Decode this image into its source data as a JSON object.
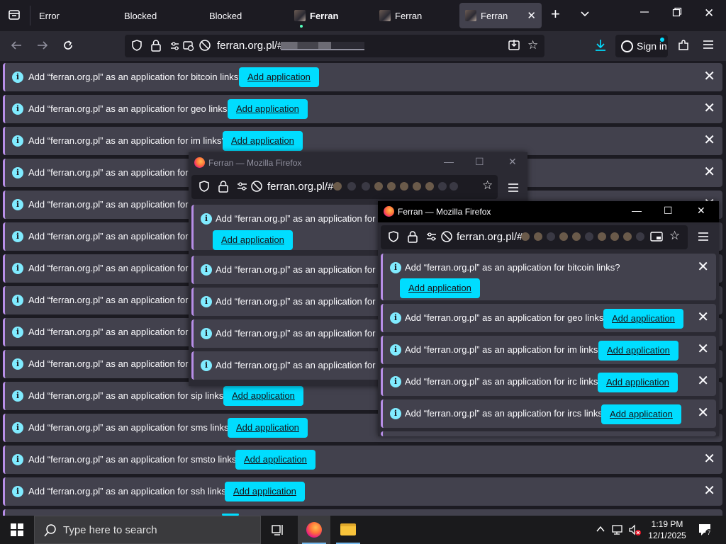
{
  "tabs": [
    {
      "label": "Error"
    },
    {
      "label": "Blocked"
    },
    {
      "label": "Blocked"
    },
    {
      "label": "Ferran"
    },
    {
      "label": "Ferran"
    },
    {
      "label": "Ferran"
    }
  ],
  "navbar": {
    "url": "ferran.org.pl/#",
    "sign_in": "Sign in"
  },
  "notifications": {
    "button_label": "Add application",
    "main": [
      "Add “ferran.org.pl” as an application for bitcoin links?",
      "Add “ferran.org.pl” as an application for geo links?",
      "Add “ferran.org.pl” as an application for im links?",
      "Add “ferran.org.pl” as an application for irc links?",
      "Add “ferran.org.pl” as an application for ircs links?",
      "Add “ferran.org.pl” as an application for mailto links?",
      "Add “ferran.org.pl” as an application for magnet links?",
      "Add “ferran.org.pl” as an application for mms links?",
      "Add “ferran.org.pl” as an application for news links?",
      "Add “ferran.org.pl” as an application for nntp links?",
      "Add “ferran.org.pl” as an application for sip links?",
      "Add “ferran.org.pl” as an application for sms links?",
      "Add “ferran.org.pl” as an application for smsto links?",
      "Add “ferran.org.pl” as an application for ssh links?"
    ]
  },
  "popup1": {
    "title": "Ferran — Mozilla Firefox",
    "url": "ferran.org.pl/#",
    "notifications": [
      "Add “ferran.org.pl” as an application for bitcoin links?",
      "Add “ferran.org.pl” as an application for geo links?",
      "Add “ferran.org.pl” as an application for im links?",
      "Add “ferran.org.pl” as an application for irc links?",
      "Add “ferran.org.pl” as an application for ircs links?"
    ]
  },
  "popup2": {
    "title": "Ferran — Mozilla Firefox",
    "url": "ferran.org.pl/#",
    "notifications": [
      "Add “ferran.org.pl” as an application for bitcoin links?",
      "Add “ferran.org.pl” as an application for geo links?",
      "Add “ferran.org.pl” as an application for im links?",
      "Add “ferran.org.pl” as an application for irc links?",
      "Add “ferran.org.pl” as an application for ircs links?"
    ]
  },
  "taskbar": {
    "search_placeholder": "Type here to search",
    "time": "1:19 PM",
    "date": "12/1/2025"
  },
  "colors": {
    "accent": "#00ddff",
    "notification_bg": "#42414d",
    "toolbar_bg": "#2b2a33",
    "frame_bg": "#1c1b22"
  }
}
